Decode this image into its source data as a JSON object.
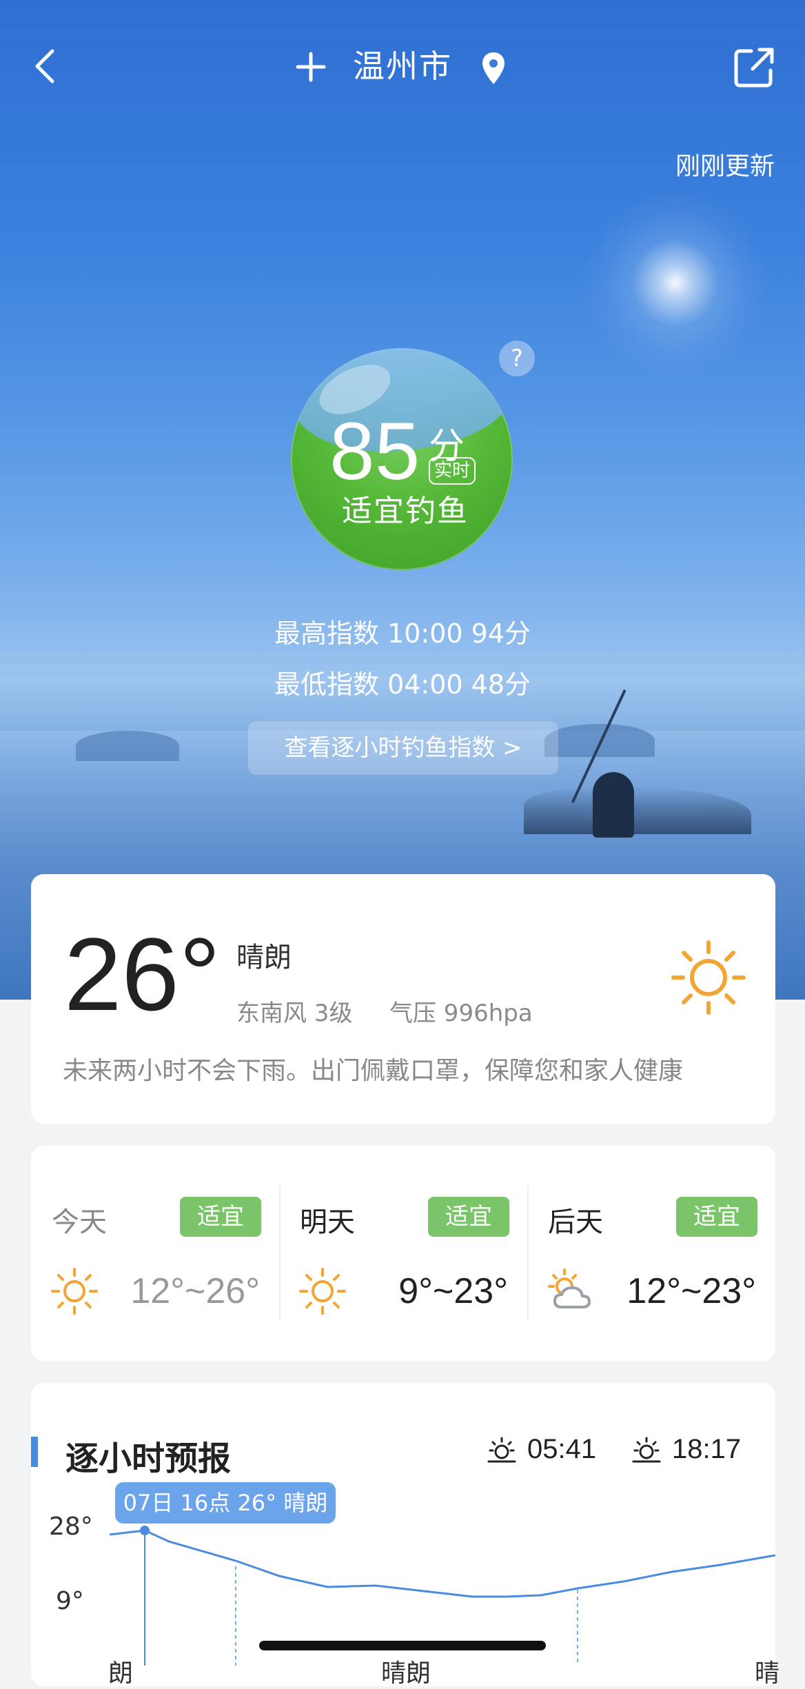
{
  "header": {
    "city": "温州市",
    "updated": "刚刚更新"
  },
  "fishing": {
    "score": "85",
    "score_unit": "分",
    "realtime_badge": "实时",
    "suitability": "适宜钓鱼",
    "help": "?",
    "max_index": "最高指数 10:00 94分",
    "min_index": "最低指数 04:00 48分",
    "hourly_button": "查看逐小时钓鱼指数 >"
  },
  "current": {
    "temp": "26°",
    "condition": "晴朗",
    "wind": "东南风 3级",
    "pressure": "气压 996hpa",
    "tip": "未来两小时不会下雨。出门佩戴口罩，保障您和家人健康",
    "icon": "sun-icon"
  },
  "days": [
    {
      "name": "今天",
      "badge": "适宜",
      "range": "12°~26°",
      "icon": "sun-icon"
    },
    {
      "name": "明天",
      "badge": "适宜",
      "range": "9°~23°",
      "icon": "sun-icon"
    },
    {
      "name": "后天",
      "badge": "适宜",
      "range": "12°~23°",
      "icon": "partly-cloudy-icon"
    }
  ],
  "hourly": {
    "title": "逐小时预报",
    "sunrise": "05:41",
    "sunset": "18:17",
    "tooltip": "07日 16点 26° 晴朗",
    "y_max": "28°",
    "y_min": "9°",
    "x_labels": [
      "朗",
      "晴朗",
      "晴"
    ]
  },
  "colors": {
    "accent": "#4a8be0",
    "badge": "#7bc46a",
    "sun": "#f2a533"
  }
}
